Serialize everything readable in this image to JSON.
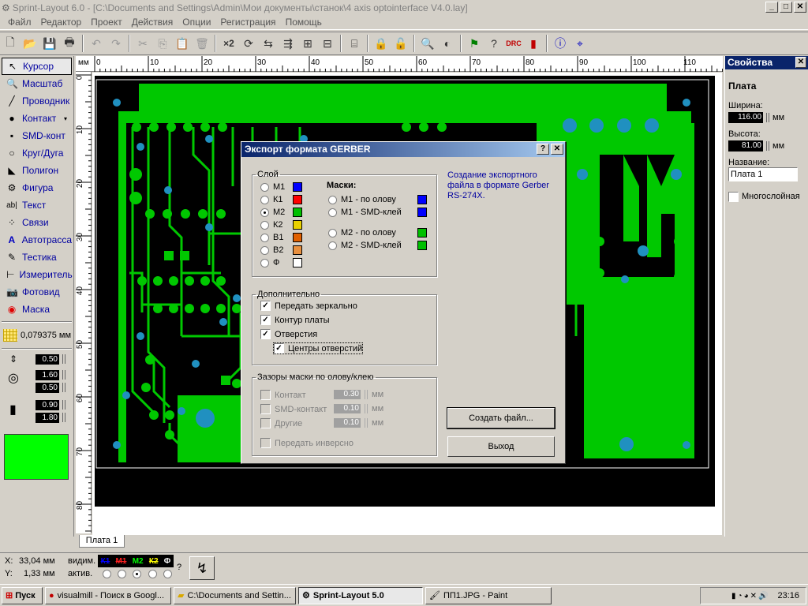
{
  "window": {
    "title": "Sprint-Layout 6.0 - [C:\\Documents and Settings\\Admin\\Мои документы\\станок\\4 axis optointerface V4.0.lay]"
  },
  "menu": [
    "Файл",
    "Редактор",
    "Проект",
    "Действия",
    "Опции",
    "Регистрация",
    "Помощь"
  ],
  "tools": [
    {
      "label": "Курсор",
      "icon": "↖"
    },
    {
      "label": "Масштаб",
      "icon": "🔍"
    },
    {
      "label": "Проводник",
      "icon": "╱"
    },
    {
      "label": "Контакт",
      "icon": "●"
    },
    {
      "label": "SMD-конт",
      "icon": "▪"
    },
    {
      "label": "Круг/Дуга",
      "icon": "○"
    },
    {
      "label": "Полигон",
      "icon": "◣"
    },
    {
      "label": "Фигура",
      "icon": "⚙"
    },
    {
      "label": "Текст",
      "icon": "ab|"
    },
    {
      "label": "Связи",
      "icon": "⁘"
    },
    {
      "label": "Автотрасса",
      "icon": "A"
    },
    {
      "label": "Тестика",
      "icon": "✎"
    },
    {
      "label": "Измеритель",
      "icon": "⊢"
    },
    {
      "label": "Фотовид",
      "icon": "📷"
    },
    {
      "label": "Маска",
      "icon": "◉"
    }
  ],
  "grid": "0,079375 мм",
  "tool_values": [
    "0.50",
    "1.60",
    "0.50",
    "0.90",
    "1.80"
  ],
  "ruler_top": [
    "мм",
    "0",
    "10",
    "20",
    "30",
    "40",
    "50",
    "60",
    "70",
    "80",
    "90",
    "100",
    "110"
  ],
  "ruler_left": [
    "0",
    "10",
    "20",
    "30",
    "40",
    "50",
    "60",
    "70",
    "80"
  ],
  "sheet_tab": "Плата 1",
  "properties": {
    "title": "Свойства",
    "section": "Плата",
    "width_label": "Ширина:",
    "width": "116.00",
    "height_label": "Высота:",
    "height": "81.00",
    "unit": "мм",
    "name_label": "Название:",
    "name": "Плата 1",
    "multilayer": "Многослойная"
  },
  "status": {
    "x": "33,04 мм",
    "y": "1,33 мм",
    "x_label": "X:",
    "y_label": "Y:",
    "visible": "видим.",
    "active": "актив.",
    "layers": [
      "К1",
      "М1",
      "М2",
      "К2",
      "Ф"
    ]
  },
  "dialog": {
    "title": "Экспорт формата GERBER",
    "layer_group": "Слой",
    "layers": [
      {
        "label": "М1",
        "color": "#0000ff"
      },
      {
        "label": "К1",
        "color": "#ff0000"
      },
      {
        "label": "М2",
        "color": "#00c000"
      },
      {
        "label": "К2",
        "color": "#e8d000"
      },
      {
        "label": "В1",
        "color": "#e06000"
      },
      {
        "label": "В2",
        "color": "#e89040"
      },
      {
        "label": "Ф",
        "color": "#ffffff"
      }
    ],
    "masks_title": "Маски:",
    "masks": [
      {
        "label": "М1 - по олову",
        "color": "#0000ff"
      },
      {
        "label": "М1 - SMD-клей",
        "color": "#0000ff"
      },
      {
        "label": "М2 - по олову",
        "color": "#00c000"
      },
      {
        "label": "М2 - SMD-клей",
        "color": "#00c000"
      }
    ],
    "description": "Создание экспортного файла в формате Gerber RS-274X.",
    "extra_group": "Дополнительно",
    "extra": [
      "Передать зеркально",
      "Контур платы",
      "Отверстия",
      "Центры отверстий"
    ],
    "clearance_group": "Зазоры маски по олову/клею",
    "clearance": [
      {
        "label": "Контакт",
        "value": "0.30"
      },
      {
        "label": "SMD-контакт",
        "value": "0.10"
      },
      {
        "label": "Другие",
        "value": "0.10"
      }
    ],
    "unit": "мм",
    "invert": "Передать инверсно",
    "create_button": "Создать файл...",
    "exit_button": "Выход"
  },
  "taskbar": {
    "start": "Пуск",
    "tasks": [
      "visualmill - Поиск в Googl...",
      "C:\\Documents and Settin...",
      "Sprint-Layout 5.0",
      "ПП1.JPG - Paint"
    ],
    "time": "23:16"
  }
}
